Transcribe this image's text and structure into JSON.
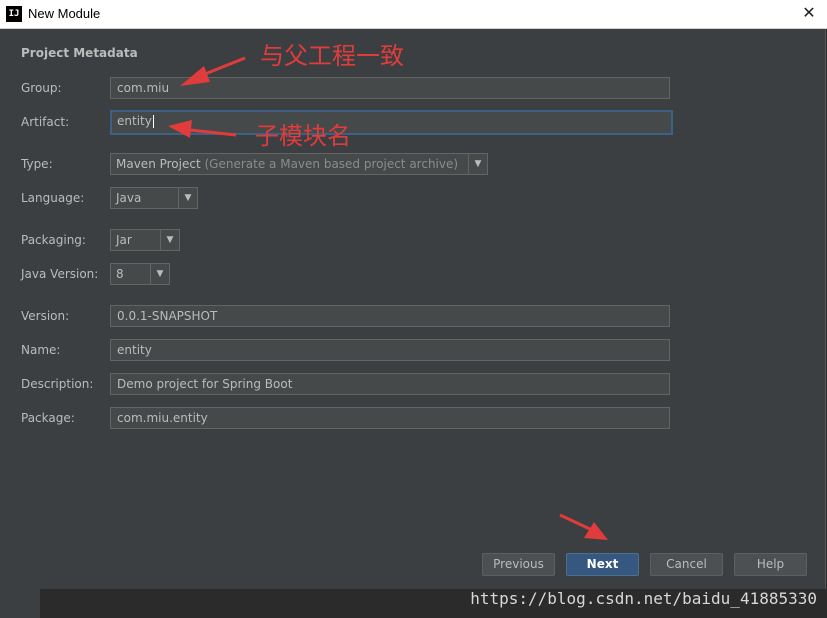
{
  "window": {
    "title": "New Module",
    "app_icon": "IJ"
  },
  "form": {
    "section_title": "Project Metadata",
    "group": {
      "label": "Group:",
      "value": "com.miu"
    },
    "artifact": {
      "label": "Artifact:",
      "value": "entity"
    },
    "type": {
      "label": "Type:",
      "value": "Maven Project",
      "hint": "(Generate a Maven based project archive)"
    },
    "language": {
      "label": "Language:",
      "value": "Java"
    },
    "packaging": {
      "label": "Packaging:",
      "value": "Jar"
    },
    "java_version": {
      "label": "Java Version:",
      "value": "8"
    },
    "version": {
      "label": "Version:",
      "value": "0.0.1-SNAPSHOT"
    },
    "name": {
      "label": "Name:",
      "value": "entity"
    },
    "description": {
      "label": "Description:",
      "value": "Demo project for Spring Boot"
    },
    "package": {
      "label": "Package:",
      "value": "com.miu.entity"
    }
  },
  "buttons": {
    "previous": "Previous",
    "next": "Next",
    "cancel": "Cancel",
    "help": "Help"
  },
  "annotations": {
    "group_note": "与父工程一致",
    "artifact_note": "子模块名"
  },
  "watermark": "https://blog.csdn.net/baidu_41885330",
  "colors": {
    "dialog_bg": "#3c3f41",
    "accent": "#365880",
    "annotation": "#e03c3c"
  }
}
